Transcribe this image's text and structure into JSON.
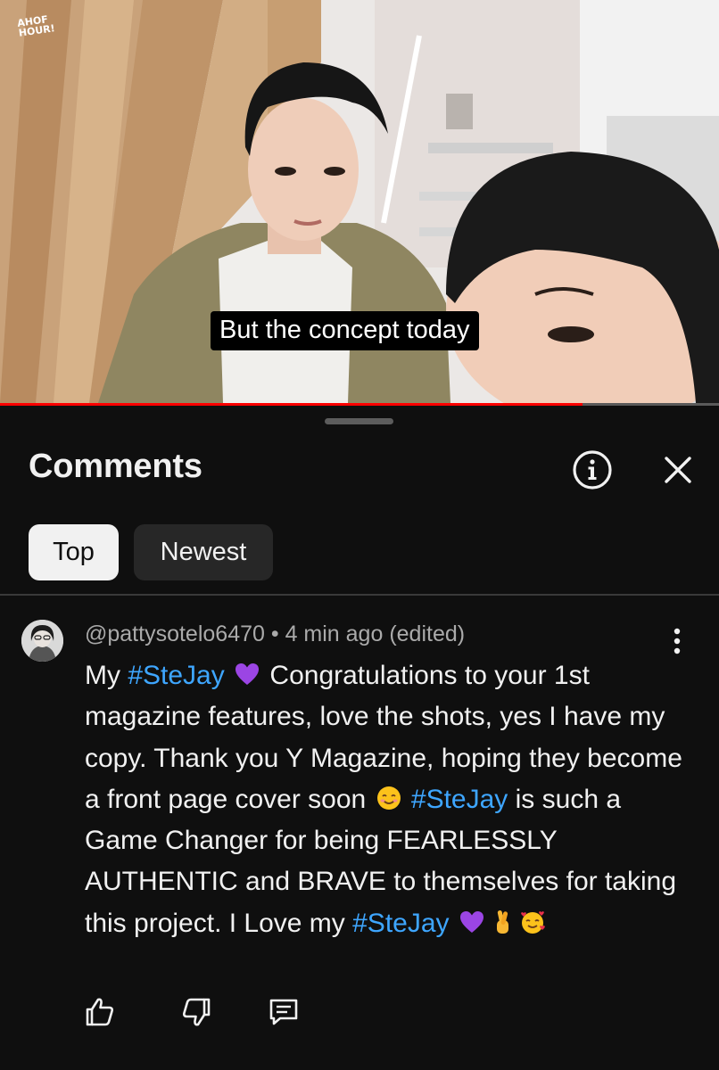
{
  "video": {
    "channel_logo_line1": "AHOF",
    "channel_logo_line2": "HOUR!",
    "caption": "But the concept today",
    "progress": 0.81
  },
  "comments_panel": {
    "title": "Comments",
    "sort_chips": [
      {
        "label": "Top",
        "selected": true
      },
      {
        "label": "Newest",
        "selected": false
      }
    ],
    "icons": {
      "info": "info-icon",
      "close": "close-icon"
    }
  },
  "comment": {
    "author": "@pattysotelo6470",
    "separator": " • ",
    "time": "4 min ago",
    "edited": "(edited)",
    "text_parts": {
      "p1": "My ",
      "tag1": "#SteJay",
      "p2": " Congratulations to your 1st magazine features, love the shots, yes I have my copy. Thank you Y Magazine, hoping they become a front page cover soon ",
      "tag2": "#SteJay",
      "p3": " is such a Game Changer for being FEARLESSLY AUTHENTIC and BRAVE to themselves for taking this project. I Love my ",
      "tag3": "#SteJay"
    },
    "emojis": [
      "purple-heart",
      "smiling-face-with-smiling-eyes",
      "purple-heart",
      "crossed-fingers",
      "smiling-face-with-hearts"
    ],
    "actions": [
      "like-icon",
      "dislike-icon",
      "reply-icon"
    ]
  },
  "colors": {
    "background": "#0f0f0f",
    "hashtag": "#3ea6ff",
    "meta_text": "#aaaaaa",
    "chip_selected": "#f1f1f1",
    "chip_unselected": "#272727"
  }
}
